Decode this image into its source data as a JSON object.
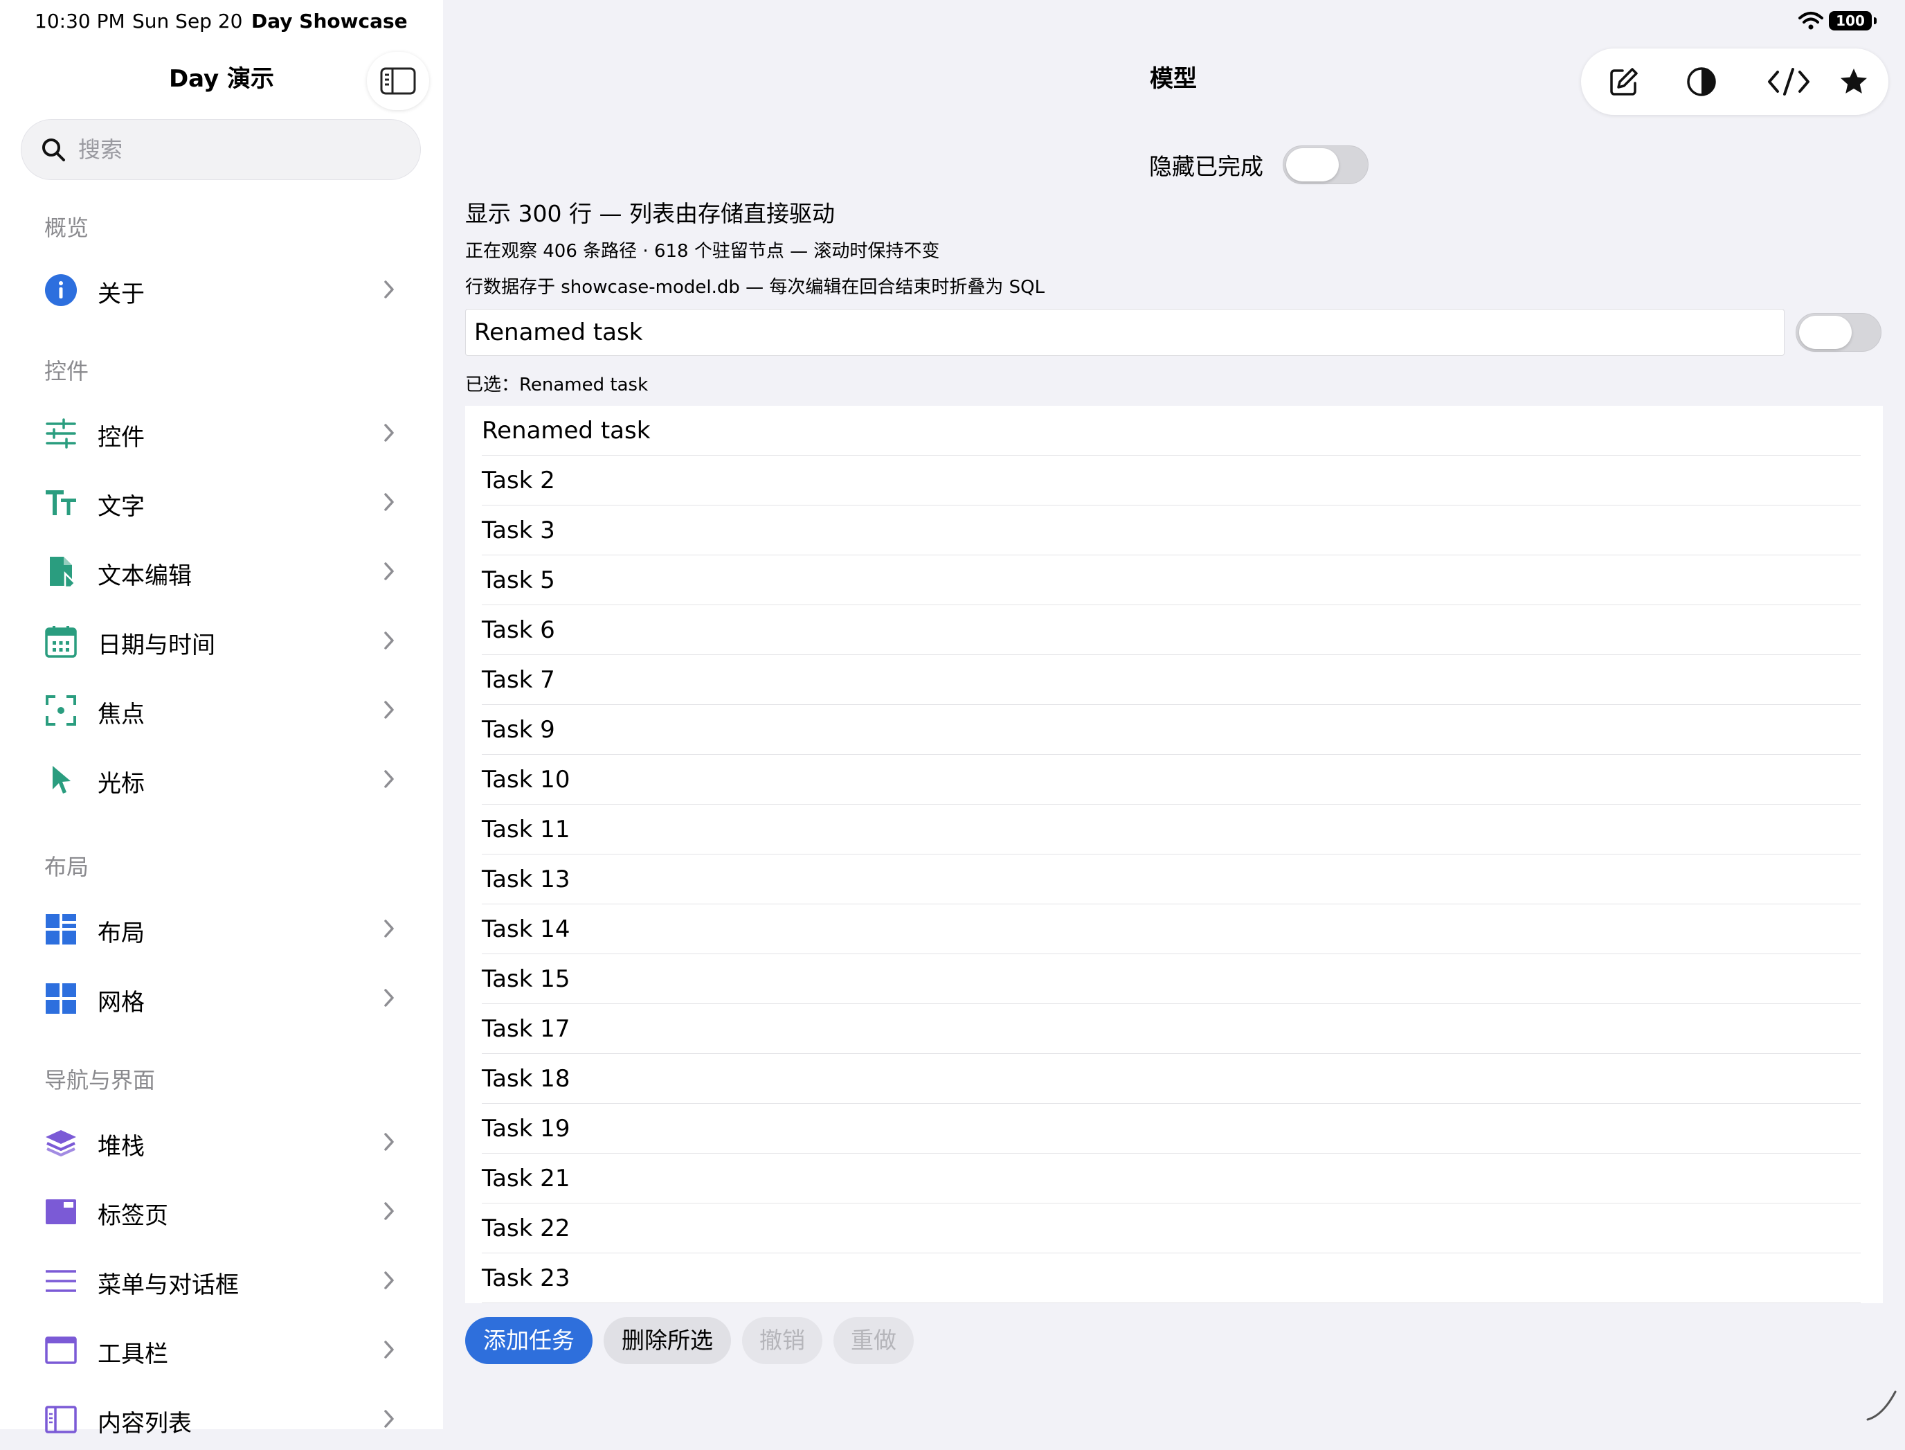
{
  "status_bar": {
    "time": "10:30 PM",
    "date": "Sun Sep 20",
    "app": "Day Showcase",
    "battery": "100"
  },
  "sidebar": {
    "title": "Day 演示",
    "search_placeholder": "搜索",
    "sections": [
      {
        "title": "概览",
        "items": [
          {
            "label": "关于",
            "icon": "info-icon",
            "color": "#2d6fde"
          }
        ]
      },
      {
        "title": "控件",
        "items": [
          {
            "label": "控件",
            "icon": "sliders-icon",
            "color": "#2a9d7f"
          },
          {
            "label": "文字",
            "icon": "text-size-icon",
            "color": "#2a9d7f"
          },
          {
            "label": "文本编辑",
            "icon": "document-edit-icon",
            "color": "#2a9d7f"
          },
          {
            "label": "日期与时间",
            "icon": "calendar-icon",
            "color": "#2a9d7f"
          },
          {
            "label": "焦点",
            "icon": "focus-icon",
            "color": "#2a9d7f"
          },
          {
            "label": "光标",
            "icon": "cursor-icon",
            "color": "#2a9d7f"
          }
        ]
      },
      {
        "title": "布局",
        "items": [
          {
            "label": "布局",
            "icon": "layout-icon",
            "color": "#2d6fde"
          },
          {
            "label": "网格",
            "icon": "grid-icon",
            "color": "#2d6fde"
          }
        ]
      },
      {
        "title": "导航与界面",
        "items": [
          {
            "label": "堆栈",
            "icon": "stack-icon",
            "color": "#7b5ad6"
          },
          {
            "label": "标签页",
            "icon": "tabs-icon",
            "color": "#7b5ad6"
          },
          {
            "label": "菜单与对话框",
            "icon": "menu-icon",
            "color": "#7b5ad6"
          },
          {
            "label": "工具栏",
            "icon": "toolbar-icon",
            "color": "#7b5ad6"
          },
          {
            "label": "内容列表",
            "icon": "content-list-icon",
            "color": "#7b5ad6"
          }
        ]
      }
    ]
  },
  "main": {
    "title": "模型",
    "toolbar_icons": [
      "compose-icon",
      "contrast-icon",
      "code-icon",
      "star-icon"
    ],
    "hide_completed_label": "隐藏已完成",
    "hide_completed_on": false,
    "info_line1": "显示 300 行 — 列表由存储直接驱动",
    "info_line2": "正在观察 406 条路径 · 618 个驻留节点 — 滚动时保持不变",
    "info_line3": "行数据存于 showcase-model.db — 每次编辑在回合结束时折叠为 SQL",
    "edit_value": "Renamed task",
    "done_toggle_on": false,
    "selected_text": "已选：Renamed task",
    "tasks": [
      "Renamed task",
      "Task 2",
      "Task 3",
      "Task 5",
      "Task 6",
      "Task 7",
      "Task 9",
      "Task 10",
      "Task 11",
      "Task 13",
      "Task 14",
      "Task 15",
      "Task 17",
      "Task 18",
      "Task 19",
      "Task 21",
      "Task 22",
      "Task 23"
    ],
    "buttons": {
      "add": "添加任务",
      "delete": "删除所选",
      "undo": "撤销",
      "redo": "重做"
    },
    "accent": "#2e6fdc"
  }
}
